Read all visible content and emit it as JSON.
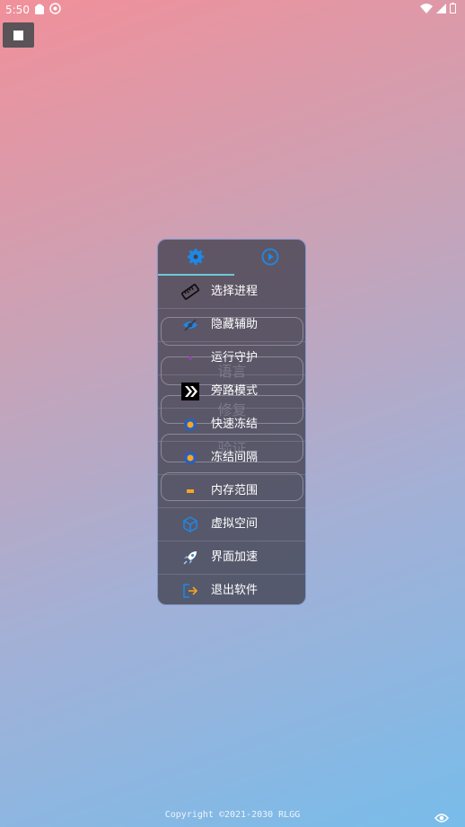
{
  "status": {
    "time": "5:50"
  },
  "tabs": [
    {
      "icon": "gear-icon"
    },
    {
      "icon": "play-circle-icon"
    }
  ],
  "ghost_labels": [
    "语言",
    "修复",
    "验证"
  ],
  "menu": [
    {
      "label": "选择进程",
      "icon": "ruler-icon"
    },
    {
      "label": "隐藏辅助",
      "icon": "eye-off-icon"
    },
    {
      "label": "运行守护",
      "icon": "shield-dot-icon"
    },
    {
      "label": "旁路模式",
      "icon": "bypass-icon"
    },
    {
      "label": "快速冻结",
      "icon": "snowflake-icon"
    },
    {
      "label": "冻结间隔",
      "icon": "snowflake-timer-icon"
    },
    {
      "label": "内存范围",
      "icon": "memory-icon"
    },
    {
      "label": "虚拟空间",
      "icon": "cube-icon"
    },
    {
      "label": "界面加速",
      "icon": "rocket-icon"
    },
    {
      "label": "退出软件",
      "icon": "exit-icon"
    }
  ],
  "footer": {
    "copyright": "Copyright ©2021-2030 RLGG"
  },
  "colors": {
    "accent": "#1e88e5",
    "tab_indicator": "#6ec9d8",
    "panel_border": "#7f95c7"
  }
}
